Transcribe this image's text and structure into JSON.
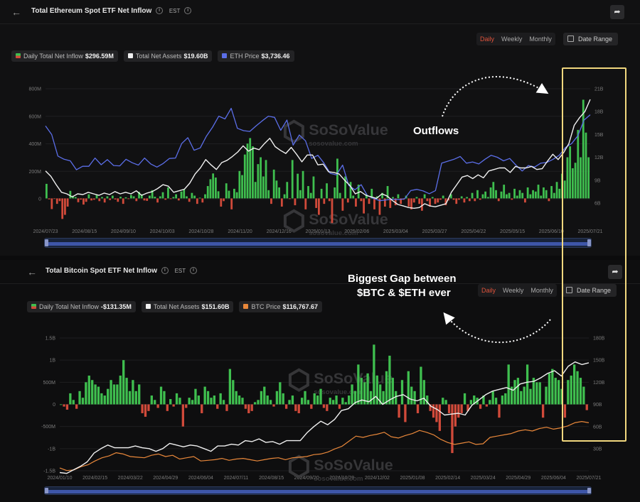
{
  "eth": {
    "title": "Total Ethereum Spot ETF Net Inflow",
    "tz": "EST",
    "periods": [
      "Daily",
      "Weekly",
      "Monthly"
    ],
    "active_period": "Daily",
    "date_range_label": "Date Range",
    "legend": {
      "inflow_label": "Daily Total Net Inflow",
      "inflow_value": "$296.59M",
      "assets_label": "Total Net Assets",
      "assets_value": "$19.60B",
      "price_label": "ETH Price",
      "price_value": "$3,736.46"
    }
  },
  "btc": {
    "title": "Total Bitcoin Spot ETF Net Inflow",
    "tz": "EST",
    "periods": [
      "Daily",
      "Weekly",
      "Monthly"
    ],
    "active_period": "Daily",
    "date_range_label": "Date Range",
    "legend": {
      "inflow_label": "Daily Total Net Inflow",
      "inflow_value": "-$131.35M",
      "assets_label": "Total Net Assets",
      "assets_value": "$151.60B",
      "price_label": "BTC Price",
      "price_value": "$116,767.67"
    }
  },
  "watermark": {
    "brand": "SoSoValue",
    "site": "sosovalue.com"
  },
  "annotations": {
    "outflows": "Outflows",
    "gap_line1": "Biggest Gap between",
    "gap_line2": "$BTC & $ETH ever",
    "highlight_color": "#f1d77e"
  },
  "colors": {
    "positive": "#3fbf4f",
    "negative": "#d14a3a",
    "assets": "#f0f0f0",
    "eth_price": "#5b6ee8",
    "btc_price": "#e8873a",
    "active": "#e0533b"
  },
  "chart_data": [
    {
      "type": "bar",
      "name": "eth-etf",
      "x_labels": [
        "2024/07/23",
        "2024/08/15",
        "2024/09/10",
        "2024/10/03",
        "2024/10/28",
        "2024/11/20",
        "2024/12/16",
        "2025/01/13",
        "2025/02/06",
        "2025/03/04",
        "2025/03/27",
        "2025/04/22",
        "2025/05/15",
        "2025/06/10",
        "2025/07/21"
      ],
      "y_left_ticks": [
        "800M",
        "600M",
        "400M",
        "200M",
        "0"
      ],
      "y_right_ticks": [
        "21B",
        "18B",
        "15B",
        "12B",
        "9B",
        "6B"
      ],
      "ylim_left": [
        -200,
        800
      ],
      "ylim_right": [
        3,
        21
      ],
      "inflow_millions": [
        106,
        -7,
        -78,
        -3,
        -40,
        -20,
        -150,
        -120,
        -60,
        55,
        20,
        10,
        -28,
        -9,
        -45,
        -25,
        30,
        -15,
        -10,
        25,
        -20,
        10,
        -30,
        15,
        -12,
        20,
        -8,
        -25,
        12,
        -40,
        8,
        -5,
        25,
        15,
        -20,
        48,
        30,
        -15,
        -18,
        20,
        60,
        12,
        -30,
        15,
        45,
        -10,
        80,
        -5,
        10,
        30,
        -15,
        50,
        65,
        15,
        -25,
        40,
        20,
        -40,
        5,
        -30,
        30,
        90,
        140,
        182,
        152,
        52,
        -60,
        -20,
        110,
        56,
        -80,
        70,
        45,
        200,
        170,
        320,
        400,
        440,
        380,
        120,
        250,
        300,
        160,
        280,
        60,
        -40,
        210,
        130,
        80,
        -60,
        30,
        120,
        -5,
        280,
        -50,
        180,
        60,
        200,
        -80,
        90,
        40,
        160,
        -70,
        -120,
        70,
        -40,
        110,
        -20,
        -180,
        80,
        290,
        40,
        -90,
        160,
        -30,
        120,
        20,
        -60,
        100,
        -20,
        -110,
        30,
        -40,
        70,
        -80,
        15,
        -120,
        40,
        -60,
        90,
        -70,
        10,
        -50,
        30,
        -40,
        -10,
        20,
        -60,
        -80,
        -30,
        10,
        -40,
        -90,
        30,
        -20,
        -60,
        10,
        -40,
        -30,
        -10,
        20,
        -50,
        -15,
        30,
        -10,
        -40,
        -10,
        15,
        -30,
        10,
        -20,
        40,
        -20,
        60,
        -10,
        30,
        50,
        10,
        80,
        120,
        60,
        -20,
        50,
        100,
        30,
        40,
        -10,
        70,
        20,
        60,
        40,
        -30,
        80,
        30,
        60,
        50,
        100,
        20,
        80,
        60,
        -20,
        90,
        40,
        120,
        70,
        180,
        130,
        300,
        380,
        220,
        260,
        500,
        300,
        720,
        480,
        300
      ],
      "assets_billions": [
        10.2,
        9.5,
        8.4,
        7.4,
        7.2,
        6.8,
        7.2,
        7.1,
        7.4,
        7.2,
        7.0,
        7.3,
        7.1,
        7.5,
        7.2,
        7.4,
        7.2,
        7.6,
        7.0,
        7.3,
        7.5,
        7.9,
        8.4,
        8.2,
        7.4,
        7.6,
        7.8,
        8.6,
        9.8,
        10.6,
        11.7,
        11.0,
        10.4,
        11.3,
        11.6,
        12.1,
        12.7,
        13.5,
        12.8,
        13.2,
        13.0,
        13.8,
        14.5,
        13.4,
        12.9,
        12.5,
        13.3,
        12.4,
        11.4,
        12.3,
        12.3,
        11.0,
        11.1,
        10.1,
        10.0,
        9.8,
        9.0,
        8.3,
        7.2,
        7.5,
        7.0,
        6.8,
        6.6,
        7.2,
        6.9,
        6.3,
        5.8,
        5.6,
        5.4,
        5.3,
        5.4,
        5.9,
        5.6,
        5.5,
        5.7,
        5.9,
        7.4,
        8.4,
        9.4,
        9.6,
        9.2,
        9.7,
        9.3,
        10.2,
        10.4,
        10.6,
        10.6,
        10.0,
        10.8,
        10.6,
        10.6,
        10.8,
        10.4,
        10.5,
        11.5,
        12.4,
        11.7,
        12.6,
        13.8,
        16.2,
        17.2,
        18.0,
        19.6
      ],
      "eth_price_usd": [
        3450,
        3230,
        2680,
        2600,
        2560,
        2330,
        2420,
        2420,
        2630,
        2460,
        2590,
        2440,
        2430,
        2600,
        2510,
        2450,
        2630,
        2480,
        2400,
        2490,
        2620,
        2630,
        3000,
        3150,
        2830,
        2890,
        3190,
        3420,
        3700,
        3630,
        3900,
        3390,
        3330,
        3310,
        3450,
        3580,
        3700,
        3670,
        3340,
        3600,
        2960,
        3220,
        3070,
        2620,
        2700,
        2500,
        2240,
        2200,
        2450,
        1930,
        1820,
        1950,
        1670,
        1600,
        1540,
        1560,
        1580,
        1570,
        1590,
        1800,
        1830,
        1790,
        1720,
        1800,
        2500,
        2550,
        2600,
        2670,
        2500,
        2530,
        2480,
        2600,
        2700,
        2650,
        2560,
        2620,
        2450,
        2300,
        2440,
        2400,
        2500,
        2520,
        2600,
        2700,
        2900,
        3000,
        3200,
        3600,
        3736
      ]
    },
    {
      "type": "bar",
      "name": "btc-etf",
      "x_labels": [
        "2024/01/10",
        "2024/02/15",
        "2024/03/22",
        "2024/04/29",
        "2024/06/04",
        "2024/07/11",
        "2024/08/15",
        "2024/09/20",
        "2024/10/29",
        "2024/12/02",
        "2025/01/08",
        "2025/02/14",
        "2025/03/24",
        "2025/04/29",
        "2025/06/04",
        "2025/07/21"
      ],
      "y_left_ticks": [
        "1.5B",
        "1B",
        "500M",
        "0",
        "-500M",
        "-1B",
        "-1.5B"
      ],
      "y_right_ticks": [
        "180B",
        "150B",
        "120B",
        "90B",
        "60B",
        "30B"
      ],
      "ylim_left": [
        -1.5,
        1.5
      ],
      "ylim_right": [
        30,
        180
      ],
      "inflow_billions": [
        0,
        -0.05,
        -0.12,
        0.25,
        0.1,
        -0.1,
        0.3,
        0.15,
        0.5,
        0.65,
        0.55,
        0.45,
        0.4,
        0.25,
        0.2,
        0.35,
        0.55,
        0.45,
        0.45,
        0.65,
        1.0,
        0.6,
        0.3,
        0.55,
        0.3,
        0.45,
        -0.2,
        -0.28,
        -0.15,
        0.2,
        0.1,
        -0.08,
        0.4,
        0.3,
        -0.15,
        0.12,
        -0.05,
        0.25,
        0.15,
        -0.5,
        -0.08,
        0.15,
        0.1,
        0.35,
        0.2,
        -0.2,
        0.4,
        0.3,
        0.15,
        0.2,
        -0.1,
        0.25,
        0.1,
        -0.15,
        0.8,
        0.55,
        0.3,
        0.2,
        0.15,
        -0.1,
        -0.2,
        -0.15,
        0.05,
        0.1,
        0.3,
        0.4,
        0.2,
        0.1,
        -0.05,
        0.3,
        0.5,
        0.25,
        -0.1,
        0.1,
        0.2,
        -0.15,
        -0.2,
        0.15,
        0.3,
        0.1,
        -0.1,
        0.25,
        0.2,
        0.35,
        -0.08,
        -0.15,
        0.15,
        0.1,
        0.2,
        -0.1,
        0.15,
        0.05,
        0.2,
        0.45,
        0.3,
        0.9,
        0.6,
        0.5,
        0.7,
        0.3,
        1.35,
        0.65,
        0.45,
        0.3,
        0.75,
        1.1,
        0.6,
        0.3,
        -0.3,
        0.55,
        -0.4,
        0.75,
        0.4,
        0.3,
        -0.2,
        0.85,
        0.55,
        0.2,
        -0.15,
        -0.3,
        -0.4,
        -0.6,
        0.15,
        0.1,
        -0.2,
        -1.1,
        -0.5,
        -0.3,
        -0.2,
        0.25,
        -0.15,
        0.1,
        0.2,
        0.15,
        -0.1,
        0.2,
        -0.05,
        0.1,
        0.3,
        0.15,
        -0.3,
        0.2,
        0.25,
        0.9,
        0.4,
        0.55,
        0.6,
        0.3,
        0.4,
        0.9,
        0.35,
        0.6,
        0.5,
        0.5,
        -0.3,
        0.4,
        0.7,
        0.8,
        0.6,
        0.55,
        0.35,
        -0.3,
        0.55,
        0.65,
        0.9,
        0.75,
        0.6,
        0.4,
        -0.13
      ],
      "assets_billions": [
        28,
        27,
        31,
        35,
        40,
        50,
        55,
        59,
        56,
        56,
        56,
        58,
        56,
        55,
        52,
        55,
        61,
        59,
        57,
        59,
        58,
        55,
        52,
        58,
        58,
        60,
        59,
        64,
        63,
        66,
        62,
        63,
        60,
        64,
        64,
        64,
        73,
        80,
        86,
        82,
        88,
        98,
        100,
        107,
        110,
        108,
        114,
        105,
        110,
        114,
        116,
        111,
        109,
        112,
        103,
        99,
        93,
        94,
        95,
        93,
        104,
        110,
        116,
        120,
        122,
        124,
        121,
        128,
        130,
        131,
        135,
        140,
        143,
        137,
        148,
        153,
        150,
        152
      ],
      "btc_price_thousands": [
        46,
        42,
        43,
        48,
        51,
        57,
        62,
        65,
        70,
        68,
        64,
        63,
        62,
        66,
        68,
        64,
        66,
        60,
        62,
        64,
        57,
        58,
        59,
        61,
        58,
        60,
        61,
        59,
        57,
        59,
        61,
        62,
        59,
        62,
        63,
        64,
        67,
        68,
        71,
        76,
        80,
        88,
        96,
        94,
        97,
        99,
        102,
        95,
        93,
        97,
        100,
        105,
        102,
        98,
        91,
        86,
        83,
        85,
        87,
        83,
        84,
        94,
        96,
        98,
        100,
        104,
        106,
        104,
        108,
        110,
        107,
        109,
        112,
        117,
        119,
        117
      ]
    }
  ]
}
